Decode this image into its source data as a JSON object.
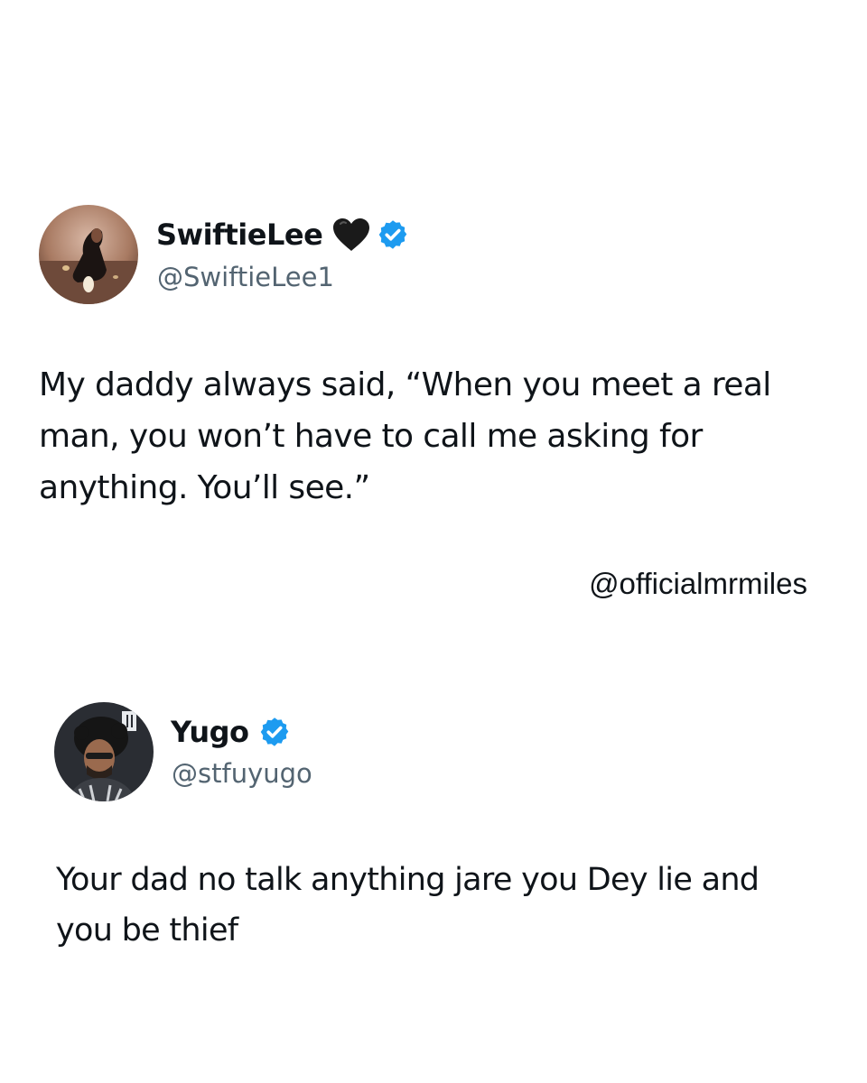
{
  "tweets": [
    {
      "display_name": "SwiftieLee",
      "name_emoji_icon": "black-heart-icon",
      "verified_icon": "verified-badge-icon",
      "handle": "@SwiftieLee1",
      "text": "My daddy always said, “When you meet a real\nman, you won’t have to call me asking for\nanything. You’ll see.”"
    },
    {
      "display_name": "Yugo",
      "verified_icon": "verified-badge-icon",
      "handle": "@stfuyugo",
      "text": "Your dad no talk anything jare you Dey lie and\nyou be thief"
    }
  ],
  "watermark": "@officialmrmiles",
  "colors": {
    "background": "#ffffff",
    "text": "#0f1419",
    "handle": "#536471",
    "verified": "#1d9bf0"
  }
}
